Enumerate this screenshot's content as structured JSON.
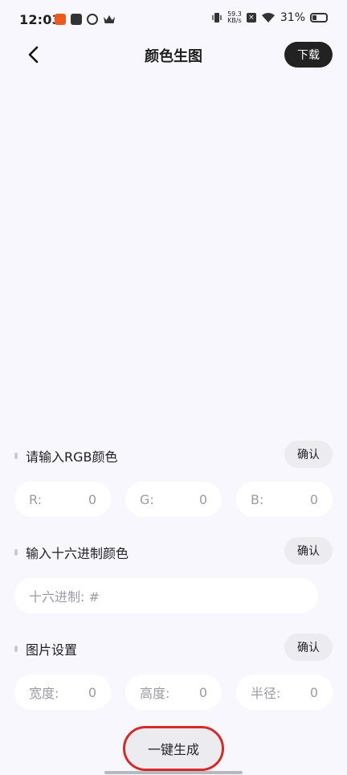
{
  "status": {
    "time": "12:03",
    "net_speed_value": "59.3",
    "net_speed_unit": "KB/s",
    "battery": "31%"
  },
  "header": {
    "title": "颜色生图",
    "download_label": "下载"
  },
  "rgb_section": {
    "title": "请输入RGB颜色",
    "confirm_label": "确认",
    "r_label": "R:",
    "r_value": "0",
    "g_label": "G:",
    "g_value": "0",
    "b_label": "B:",
    "b_value": "0"
  },
  "hex_section": {
    "title": "输入十六进制颜色",
    "confirm_label": "确认",
    "placeholder": "十六进制: #"
  },
  "image_section": {
    "title": "图片设置",
    "confirm_label": "确认",
    "width_label": "宽度:",
    "width_value": "0",
    "height_label": "高度:",
    "height_value": "0",
    "radius_label": "半径:",
    "radius_value": "0"
  },
  "generate_label": "一键生成"
}
